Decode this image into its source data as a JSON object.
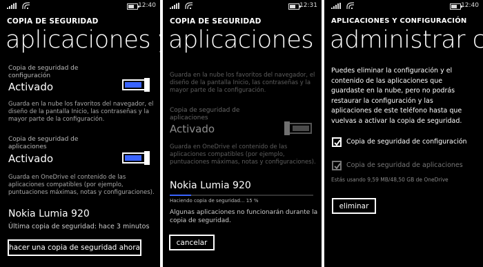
{
  "screen1": {
    "status": {
      "time": "12:40",
      "battery_level": 0.7
    },
    "app_title": "COPIA DE SEGURIDAD",
    "page_title": "aplicaciones y c",
    "config_backup": {
      "label_line1": "Copia de seguridad de",
      "label_line2": "configuración",
      "value": "Activado",
      "toggle_on": true,
      "description": [
        "Guarda en la nube los favoritos del navegador, el",
        "diseño de la pantalla Inicio, las contraseñas y la",
        "mayor parte de la configuración."
      ]
    },
    "apps_backup": {
      "label_line1": "Copia de seguridad de",
      "label_line2": "aplicaciones",
      "value": "Activado",
      "toggle_on": true,
      "description": [
        "Guarda en OneDrive el contenido de las",
        "aplicaciones compatibles (por ejemplo,",
        "puntuaciones máximas, notas y configuraciones)."
      ]
    },
    "device_name": "Nokia Lumia 920",
    "last_backup": "Última copia de seguridad: hace 3 minutos",
    "backup_now_button": "hacer una copia de seguridad ahora"
  },
  "screen2": {
    "status": {
      "time": "12:31",
      "battery_level": 0.7
    },
    "app_title": "COPIA DE SEGURIDAD",
    "page_title": "aplicaciones y c",
    "config_description": [
      "Guarda en la nube los favoritos del navegador, el",
      "diseño de la pantalla Inicio, las contraseñas y la",
      "mayor parte de la configuración."
    ],
    "apps_backup": {
      "label_line1": "Copia de seguridad de",
      "label_line2": "aplicaciones",
      "value": "Activado",
      "toggle_on": false,
      "description": [
        "Guarda en OneDrive el contenido de las",
        "aplicaciones compatibles (por ejemplo,",
        "puntuaciones máximas, notas y configuraciones)."
      ]
    },
    "device_name": "Nokia Lumia 920",
    "progress_text": "Haciendo copia de seguridad... 15 %",
    "progress_value": 0.15,
    "warning": [
      "Algunas aplicaciones no funcionarán durante la",
      "copia de seguridad."
    ],
    "cancel_button": "cancelar"
  },
  "screen3": {
    "status": {
      "time": "12:40",
      "battery_level": 0.7
    },
    "app_title": "APLICACIONES Y CONFIGURACIÓN",
    "page_title": "administrar cop",
    "intro": [
      "Puedes eliminar la configuración y el",
      "contenido de las aplicaciones que",
      "guardaste en la nube, pero no podrás",
      "restaurar la configuración y las",
      "aplicaciones de este teléfono hasta que",
      "vuelvas a activar la copia de seguridad."
    ],
    "config_checkbox_label": "Copia de seguridad de configuración",
    "config_checked": true,
    "apps_checkbox_label": "Copia de seguridad de aplicaciones",
    "apps_checked": true,
    "usage": "Estás usando 9,59 MB/48,50 GB de OneDrive",
    "delete_button": "eliminar"
  }
}
